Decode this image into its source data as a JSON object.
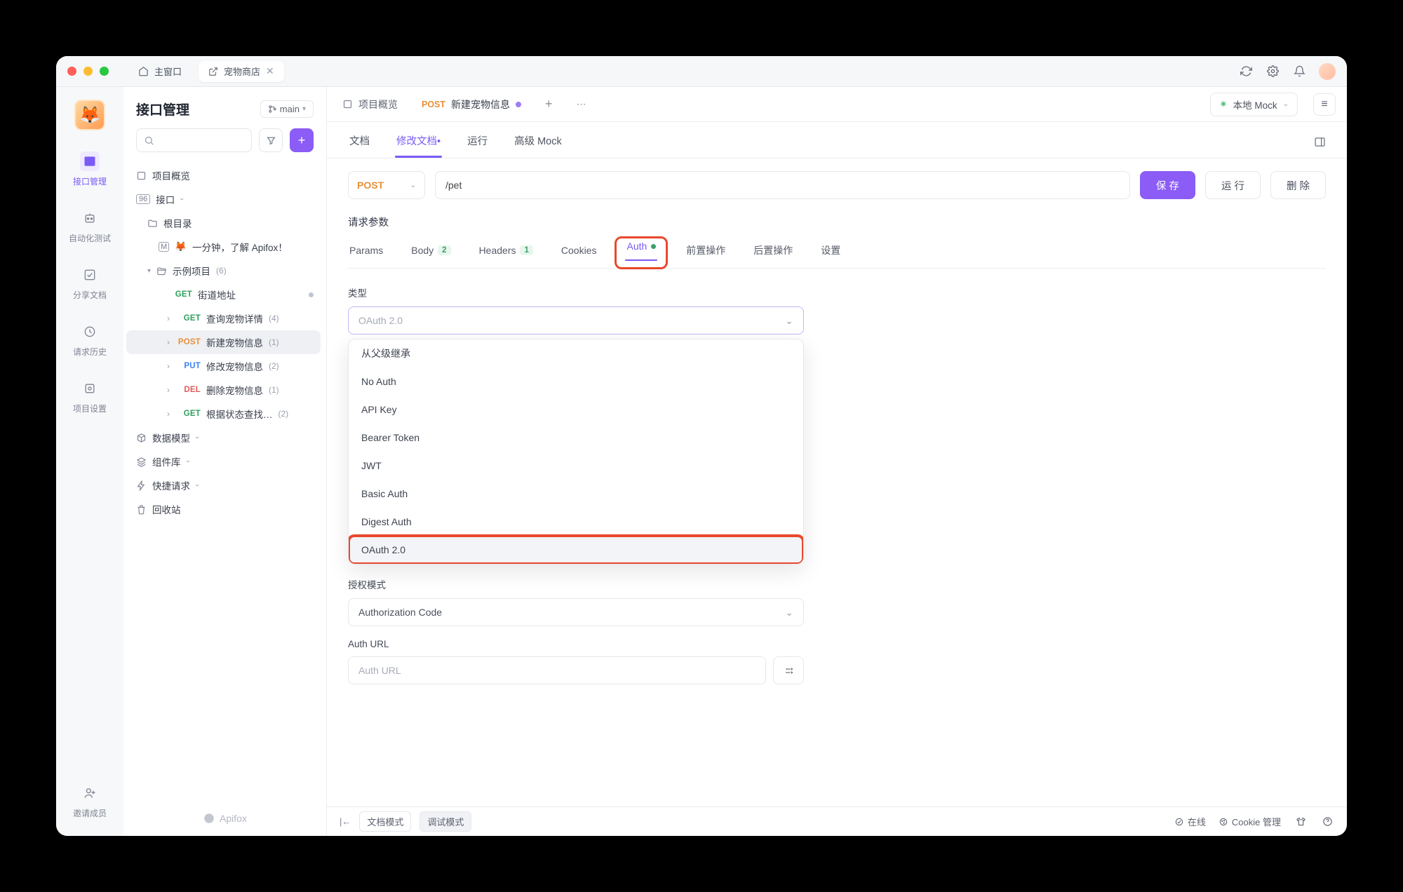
{
  "titlebar": {
    "home_tab": "主窗口",
    "store_tab": "宠物商店"
  },
  "rail": {
    "items": [
      {
        "label": "接口管理"
      },
      {
        "label": "自动化测试"
      },
      {
        "label": "分享文档"
      },
      {
        "label": "请求历史"
      },
      {
        "label": "项目设置"
      },
      {
        "label": "邀请成员"
      }
    ]
  },
  "sidebar": {
    "title": "接口管理",
    "branch": "main",
    "overview": "项目概览",
    "api_root_label": "接口",
    "root_dir": "根目录",
    "learn_apifox": "一分钟，了解 Apifox！",
    "example_proj": "示例项目",
    "example_proj_count": "(6)",
    "apis": [
      {
        "method": "GET",
        "cls": "m-get",
        "name": "街道地址",
        "count": ""
      },
      {
        "method": "GET",
        "cls": "m-get",
        "name": "查询宠物详情",
        "count": "(4)"
      },
      {
        "method": "POST",
        "cls": "m-post",
        "name": "新建宠物信息",
        "count": "(1)"
      },
      {
        "method": "PUT",
        "cls": "m-put",
        "name": "修改宠物信息",
        "count": "(2)"
      },
      {
        "method": "DEL",
        "cls": "m-del",
        "name": "删除宠物信息",
        "count": "(1)"
      },
      {
        "method": "GET",
        "cls": "m-get",
        "name": "根据状态查找…",
        "count": "(2)"
      }
    ],
    "data_model": "数据模型",
    "components": "组件库",
    "quick_req": "快捷请求",
    "trash": "回收站",
    "brand": "Apifox"
  },
  "tabs": {
    "overview": "项目概览",
    "api_tab_method": "POST",
    "api_tab_name": "新建宠物信息",
    "env": "本地 Mock"
  },
  "subtabs": {
    "doc": "文档",
    "edit_doc": "修改文档",
    "run": "运行",
    "adv_mock": "高级 Mock"
  },
  "url_row": {
    "method": "POST",
    "path": "/pet",
    "save": "保 存",
    "run": "运 行",
    "delete": "删 除"
  },
  "req": {
    "section_title": "请求参数",
    "tabs": {
      "params": "Params",
      "body": "Body",
      "body_badge": "2",
      "headers": "Headers",
      "headers_badge": "1",
      "cookies": "Cookies",
      "auth": "Auth",
      "pre": "前置操作",
      "post": "后置操作",
      "settings": "设置"
    }
  },
  "auth": {
    "type_label": "类型",
    "type_placeholder": "OAuth 2.0",
    "options": [
      "从父级继承",
      "No Auth",
      "API Key",
      "Bearer Token",
      "JWT",
      "Basic Auth",
      "Digest Auth",
      "OAuth 2.0"
    ],
    "mode_label": "授权模式",
    "mode_value": "Authorization Code",
    "auth_url_label": "Auth URL",
    "auth_url_placeholder": "Auth URL"
  },
  "statusbar": {
    "doc_mode": "文档模式",
    "debug_mode": "调试模式",
    "online": "在线",
    "cookie_mgr": "Cookie 管理"
  }
}
